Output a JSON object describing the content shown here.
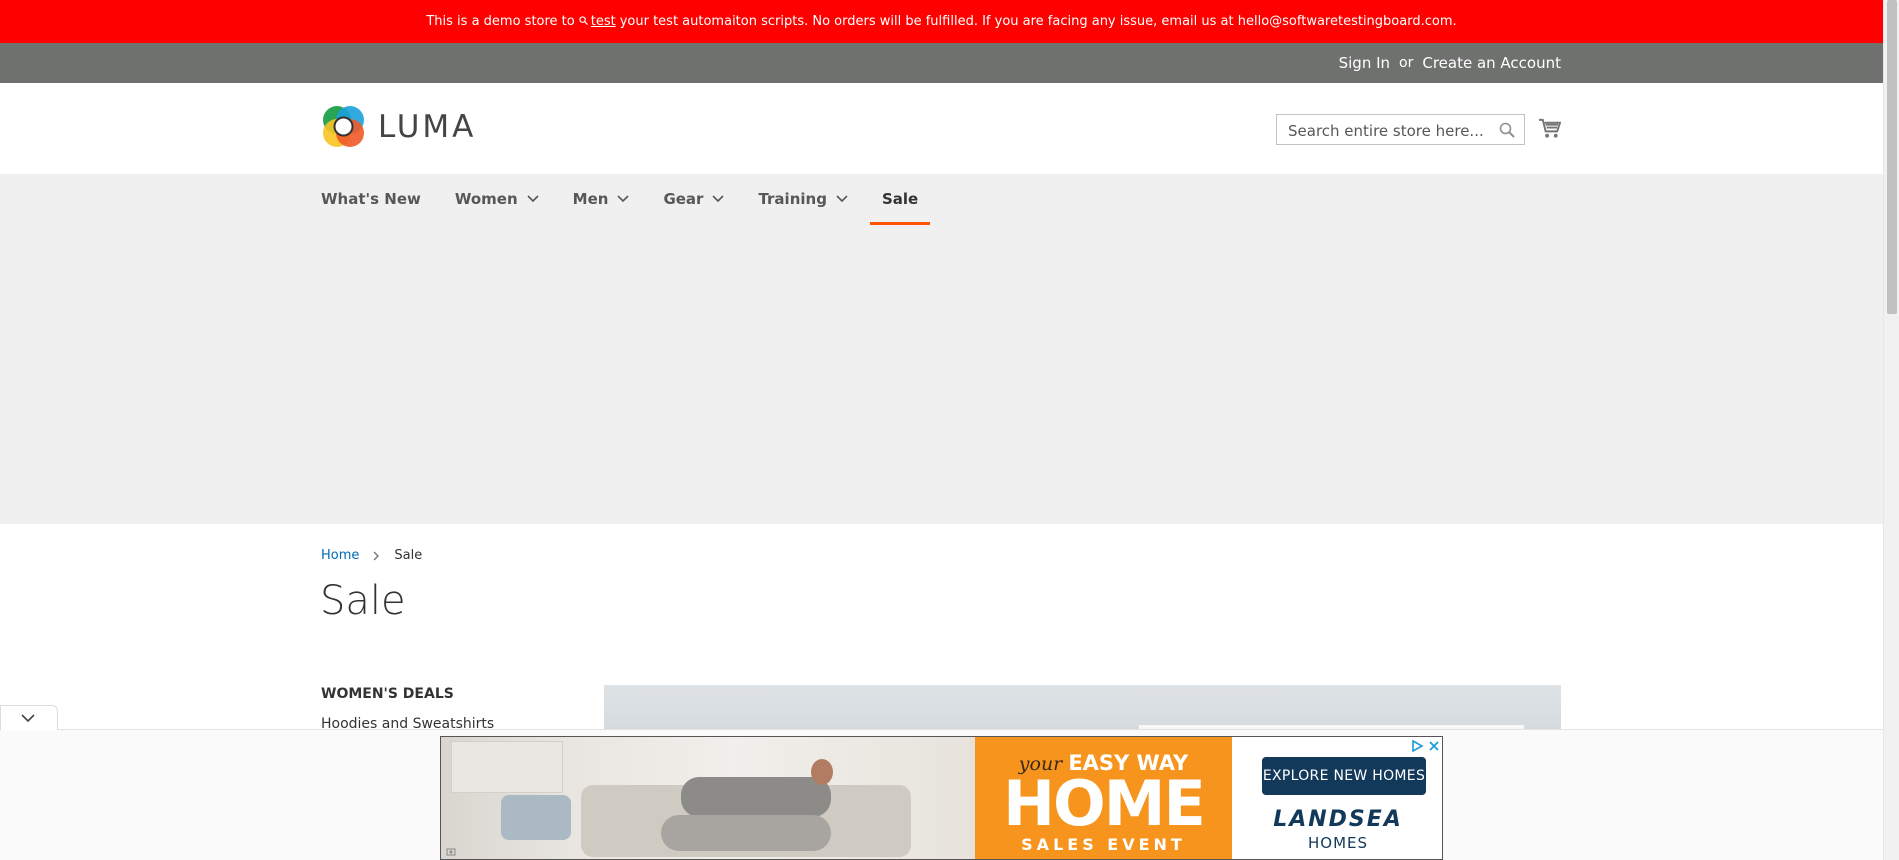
{
  "notice": {
    "prefix": "This is a demo store to",
    "link": "test",
    "suffix": "your test automaiton scripts. No orders will be fulfilled. If you are facing any issue, email us at hello@softwaretestingboard.com."
  },
  "header_links": {
    "sign_in": "Sign In",
    "or": "or",
    "create_account": "Create an Account"
  },
  "logo": {
    "text": "LUMA"
  },
  "search": {
    "placeholder": "Search entire store here...",
    "value": ""
  },
  "nav": {
    "items": [
      {
        "label": "What's New"
      },
      {
        "label": "Women"
      },
      {
        "label": "Men"
      },
      {
        "label": "Gear"
      },
      {
        "label": "Training"
      },
      {
        "label": "Sale"
      }
    ]
  },
  "breadcrumbs": {
    "home": "Home",
    "current": "Sale"
  },
  "page": {
    "title": "Sale"
  },
  "sidebar": {
    "heading": "WOMEN'S DEALS",
    "links": [
      "Hoodies and Sweatshirts"
    ]
  },
  "ad": {
    "tagline_prefix": "your",
    "tagline_main": "EASY WAY",
    "headline": "HOME",
    "subheadline": "SALES EVENT",
    "cta": "EXPLORE NEW HOMES",
    "brand": "LANDSEA",
    "brand_sub": "HOMES"
  },
  "colors": {
    "notice_bg": "#ff0000",
    "panel_bg": "#6e716e",
    "nav_bg": "#f0f0f0",
    "nav_active_underline": "#ff5501",
    "link": "#006bb4",
    "ad_orange": "#f7941d",
    "ad_navy": "#12385a"
  },
  "icons": [
    "search-icon",
    "cart-icon",
    "chevron-down-icon",
    "chevron-right-icon",
    "close-icon",
    "ad-choices-icon"
  ]
}
